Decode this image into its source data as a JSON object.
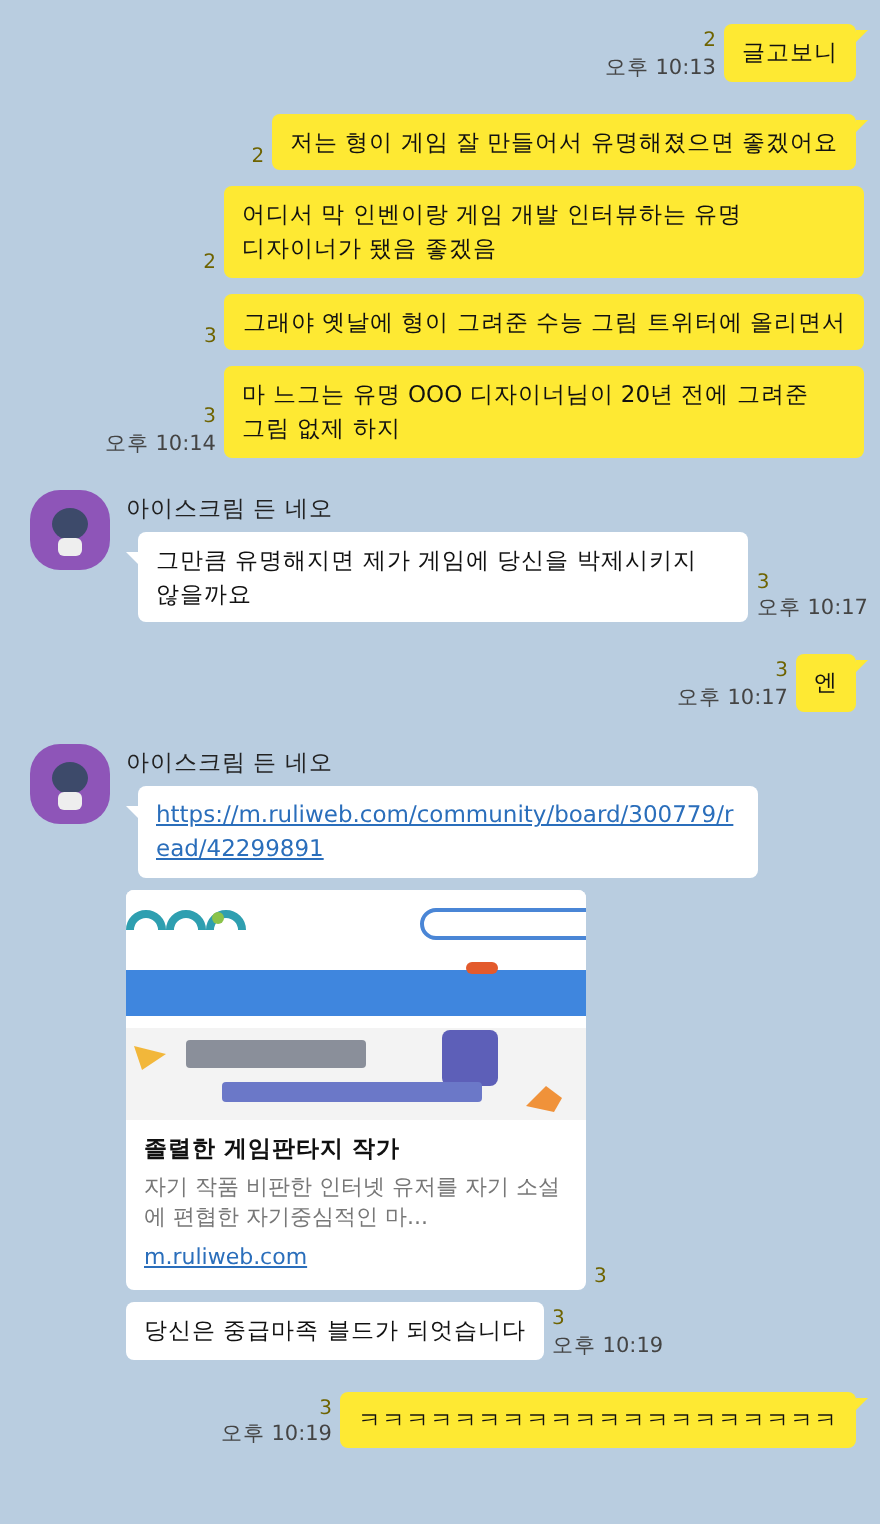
{
  "messages": [
    {
      "kind": "sent",
      "text": "글고보니",
      "unread": "2",
      "time": "오후 10:13",
      "tail": true
    },
    {
      "kind": "sent",
      "text": "저는 형이 게임 잘 만들어서 유명해졌으면 좋겠어요",
      "unread": "2",
      "tail": true
    },
    {
      "kind": "sent",
      "text": "어디서 막 인벤이랑 게임 개발 인터뷰하는 유명 디자이너가 됐음 좋겠음",
      "unread": "2",
      "tail": false
    },
    {
      "kind": "sent",
      "text": "그래야 옛날에 형이 그려준 수능 그림 트위터에 올리면서",
      "unread": "3",
      "tail": false
    },
    {
      "kind": "sent",
      "text": "마 느그는 유명 OOO 디자이너님이 20년 전에 그려준 그림 없제 하지",
      "unread": "3",
      "time": "오후 10:14",
      "tail": false
    },
    {
      "kind": "received",
      "sender": "아이스크림 든 네오",
      "text": "그만큼 유명해지면 제가 게임에 당신을 박제시키지 않을까요",
      "unread": "3",
      "time": "오후 10:17"
    },
    {
      "kind": "sent",
      "text": "엔",
      "unread": "3",
      "time": "오후 10:17",
      "tail": true
    },
    {
      "kind": "link",
      "sender": "아이스크림 든 네오",
      "url": "https://m.ruliweb.com/community/board/300779/read/42299891"
    },
    {
      "kind": "preview",
      "title": "졸렬한 게임판타지 작가",
      "description": "자기 작품 비판한 인터넷 유저를 자기 소설에 편협한 자기중심적인 마...",
      "domain": "m.ruliweb.com",
      "unread": "3"
    },
    {
      "kind": "received",
      "text": "당신은 중급마족 블드가 되엇습니다",
      "unread": "3",
      "time": "오후 10:19"
    },
    {
      "kind": "sent",
      "text": "ㅋㅋㅋㅋㅋㅋㅋㅋㅋㅋㅋㅋㅋㅋㅋㅋㅋㅋㅋㅋ",
      "unread": "3",
      "time": "오후 10:19",
      "tail": true
    }
  ]
}
